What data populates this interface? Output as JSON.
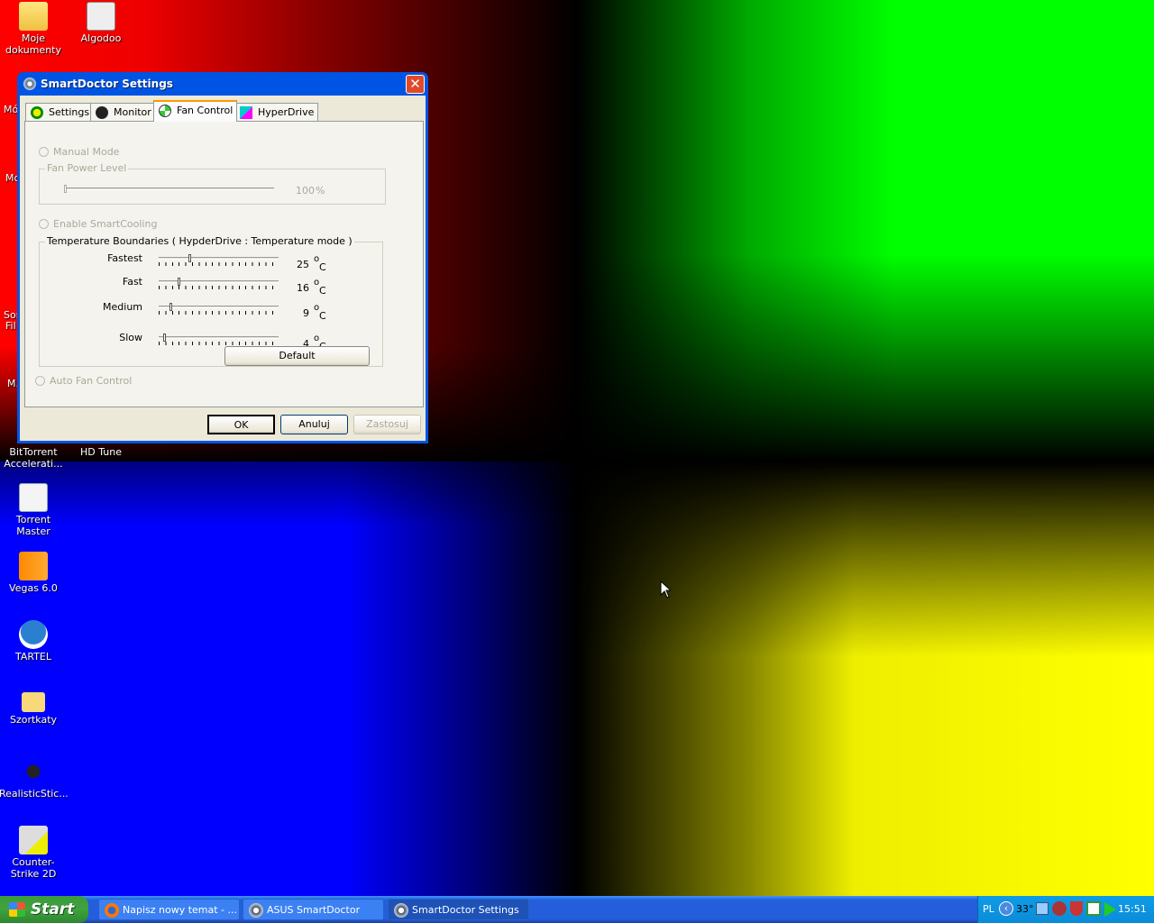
{
  "desktop": {
    "icons": [
      {
        "label": "Moje dokumenty",
        "icon": "folder-documents-icon"
      },
      {
        "label": "Algodoo",
        "icon": "algodoo-icon"
      },
      {
        "label": "BitTorrent Accelerati...",
        "icon": "bittorrent-icon"
      },
      {
        "label": "HD Tune",
        "icon": "hdtune-icon"
      },
      {
        "label": "Torrent Master",
        "icon": "torrent-master-icon"
      },
      {
        "label": "Vegas 6.0",
        "icon": "vegas-icon"
      },
      {
        "label": "TARTEL",
        "icon": "tartel-icon"
      },
      {
        "label": "Szortkaty",
        "icon": "folder-icon"
      },
      {
        "label": "RealisticStic...",
        "icon": "realisticstick-icon"
      },
      {
        "label": "Counter-Strike 2D",
        "icon": "counter-strike-icon"
      }
    ],
    "partial": [
      "Mó",
      "Mc",
      "Sor",
      "Fil",
      "M."
    ]
  },
  "dialog": {
    "title": "SmartDoctor Settings",
    "tabs": [
      {
        "label": "Settings"
      },
      {
        "label": "Monitor"
      },
      {
        "label": "Fan Control",
        "selected": true
      },
      {
        "label": "HyperDrive"
      }
    ],
    "manual_mode": "Manual Mode",
    "fan_power_level": {
      "label": "Fan Power Level",
      "value": "100",
      "unit": "%"
    },
    "smart_cooling": "Enable SmartCooling",
    "temperature_boundaries": {
      "label": "Temperature Boundaries ( HypderDrive : Temperature mode )",
      "rows": [
        {
          "label": "Fastest",
          "value": "25",
          "unit_o": "o",
          "unit_c": "C",
          "level": 25
        },
        {
          "label": "Fast",
          "value": "16",
          "unit_o": "o",
          "unit_c": "C",
          "level": 16
        },
        {
          "label": "Medium",
          "value": "9",
          "unit_o": "o",
          "unit_c": "C",
          "level": 9
        },
        {
          "label": "Slow",
          "value": "4",
          "unit_o": "o",
          "unit_c": "C",
          "level": 4
        }
      ],
      "default_button": "Default"
    },
    "auto_fan": "Auto Fan Control",
    "buttons": {
      "ok": "OK",
      "cancel": "Anuluj",
      "apply": "Zastosuj"
    }
  },
  "taskbar": {
    "start": "Start",
    "tasks": [
      {
        "label": "Napisz nowy temat - ..."
      },
      {
        "label": "ASUS SmartDoctor"
      },
      {
        "label": "SmartDoctor Settings",
        "active": true
      }
    ],
    "tray": {
      "lang": "PL",
      "temp": "33°",
      "clock": "15:51"
    }
  }
}
